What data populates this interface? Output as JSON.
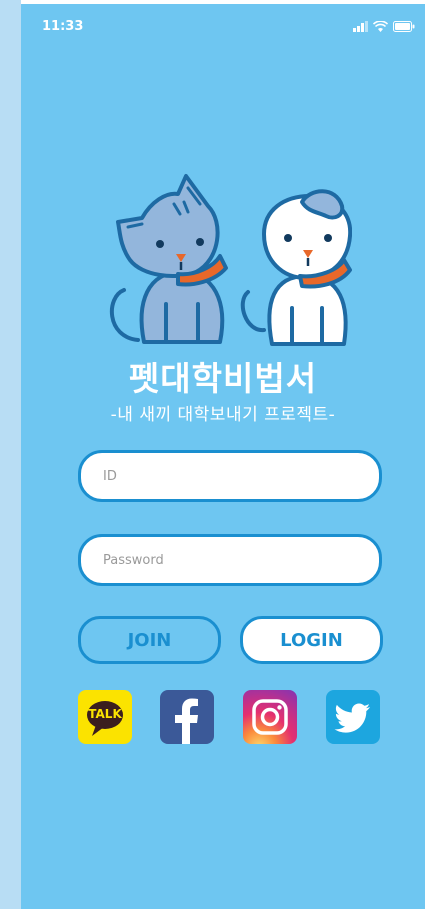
{
  "status": {
    "time": "11:33"
  },
  "app": {
    "title": "펫대학비법서",
    "subtitle": "-내 새끼 대학보내기 프로젝트-"
  },
  "form": {
    "id_placeholder": "ID",
    "password_placeholder": "Password",
    "join_label": "JOIN",
    "login_label": "LOGIN"
  },
  "social": [
    {
      "name": "kakaotalk",
      "label": "TALK",
      "color": "#fbe300"
    },
    {
      "name": "facebook",
      "color": "#3b5998"
    },
    {
      "name": "instagram",
      "color": "#e5306f"
    },
    {
      "name": "twitter",
      "color": "#1da6df"
    }
  ],
  "colors": {
    "background": "#6ec6f1",
    "accent": "#1a8fd0"
  }
}
